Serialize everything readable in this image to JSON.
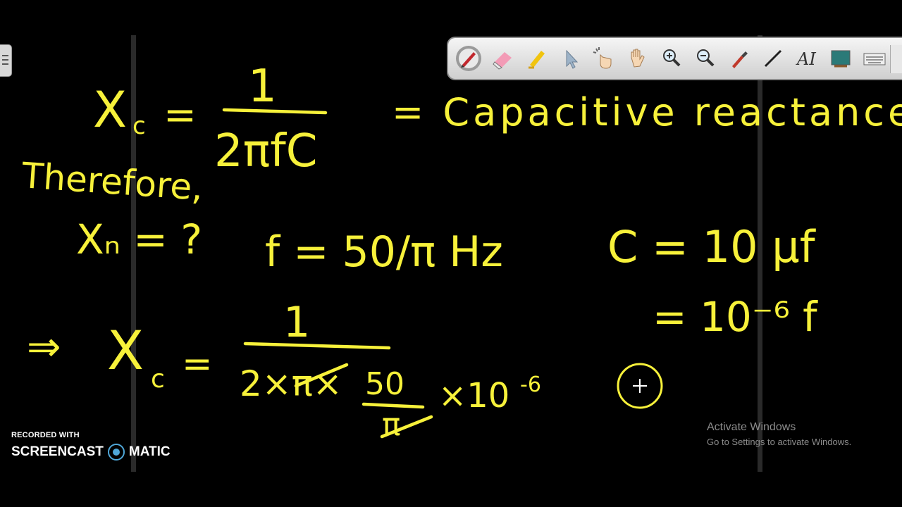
{
  "board": {
    "formula_main": {
      "lhs_symbol": "X",
      "lhs_sub": "c",
      "equals": "=",
      "numerator": "1",
      "denominator": "2πfC",
      "meaning": "= Capacitive reactance"
    },
    "therefore_label": "Therefore,",
    "givens": {
      "xc_unknown": "Xₙ = ?",
      "frequency": "f = 50/π Hz",
      "capacitance_1": "C = 10 μf",
      "capacitance_2": "= 10⁻⁶ f"
    },
    "substitution": {
      "implies": "⇒",
      "lhs": "X",
      "lhs_sub": "c",
      "equals": "=",
      "numerator": "1",
      "denominator_left": "2×π×",
      "denominator_frac_num": "50",
      "denominator_frac_den": "π",
      "denominator_right": "×10",
      "exponent": "-6"
    },
    "ink_color": "#f7f13a"
  },
  "toolbar": {
    "tools": [
      {
        "name": "pen-icon"
      },
      {
        "name": "eraser-icon"
      },
      {
        "name": "highlighter-icon"
      },
      {
        "name": "pointer-icon"
      },
      {
        "name": "click-hand-icon"
      },
      {
        "name": "pan-hand-icon"
      },
      {
        "name": "zoom-in-icon"
      },
      {
        "name": "zoom-out-icon"
      },
      {
        "name": "color-picker-icon"
      },
      {
        "name": "line-icon"
      },
      {
        "name": "text-icon"
      },
      {
        "name": "whiteboard-icon"
      },
      {
        "name": "keyboard-icon"
      }
    ],
    "text_tool_label": "AI"
  },
  "watermark": {
    "small": "RECORDED WITH",
    "brand_left": "SCREENCAST",
    "brand_right": "MATIC"
  },
  "activation": {
    "title": "Activate Windows",
    "subtitle": "Go to Settings to activate Windows."
  }
}
